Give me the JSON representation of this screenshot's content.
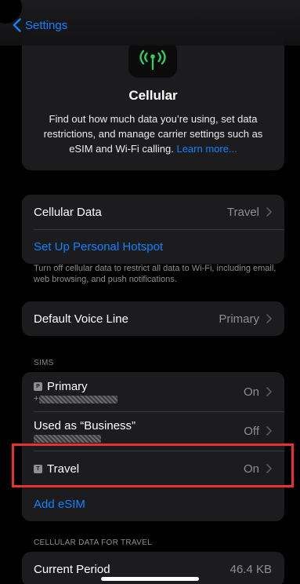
{
  "nav": {
    "back_label": "Settings"
  },
  "hero": {
    "title": "Cellular",
    "description": "Find out how much data you’re using, set data restrictions, and manage carrier settings such as eSIM and Wi-Fi calling.",
    "link": "Learn more..."
  },
  "data_group": {
    "cellular_data": {
      "label": "Cellular Data",
      "value": "Travel"
    },
    "hotspot": {
      "label": "Set Up Personal Hotspot"
    }
  },
  "data_note": "Turn off cellular data to restrict all data to Wi-Fi, including email, web browsing, and push notifications.",
  "voice_line": {
    "label": "Default Voice Line",
    "value": "Primary"
  },
  "sims": {
    "header": "SIMs",
    "items": [
      {
        "badge": "P",
        "name": "Primary",
        "status": "On",
        "subtitle_prefix": "+"
      },
      {
        "badge": "",
        "name": "Used as “Business”",
        "status": "Off",
        "subtitle_prefix": ""
      },
      {
        "badge": "T",
        "name": "Travel",
        "status": "On",
        "subtitle_prefix": ""
      }
    ],
    "add_esim": "Add eSIM"
  },
  "usage": {
    "header": "CELLULAR DATA FOR TRAVEL",
    "current_period": {
      "label": "Current Period",
      "value": "46.4 KB"
    }
  },
  "colors": {
    "accent": "#0a84ff",
    "signal_green": "#30d158",
    "highlight": "#e8322f"
  },
  "icons": {
    "back": "chevron-left-icon",
    "app": "cellular-antenna-icon",
    "disclosure": "chevron-right-icon"
  }
}
